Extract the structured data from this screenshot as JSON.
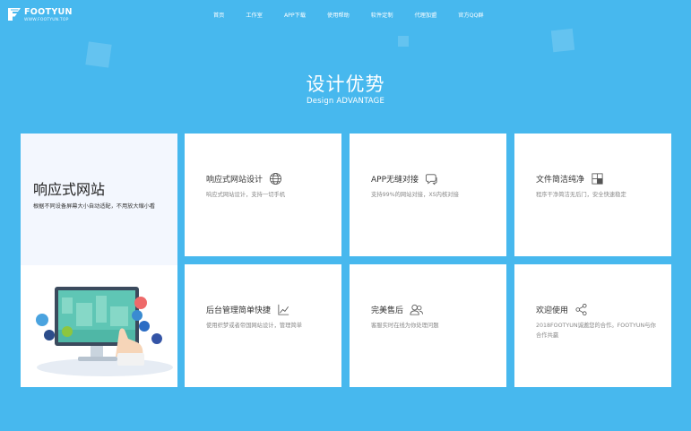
{
  "header": {
    "logo_text": "FOOTYUN",
    "logo_sub": "WWW.FOOTYUN.TOP",
    "nav": [
      "首页",
      "工作室",
      "APP下载",
      "使用帮助",
      "软件定制",
      "代理加盟",
      "官方QQ群"
    ]
  },
  "section": {
    "title": "设计优势",
    "subtitle": "Design ADVANTAGE"
  },
  "feature_big": {
    "title": "响应式网站",
    "desc": "根据不同设备屏幕大小自动适配，不用放大缩小看"
  },
  "cards": [
    {
      "title": "响应式网站设计",
      "icon": "globe-icon",
      "desc": "响应式网站设计，支持一切手机"
    },
    {
      "title": "APP无缝对接",
      "icon": "chat-bubble-icon",
      "desc": "支持99%的网站对接，XS内核对接"
    },
    {
      "title": "文件简洁纯净",
      "icon": "layout-icon",
      "desc": "程序干净简洁无后门，安全快速稳定"
    },
    {
      "title": "后台管理简单快捷",
      "icon": "line-chart-icon",
      "desc": "使用织梦或者帝国网站设计，管理简单"
    },
    {
      "title": "完美售后",
      "icon": "users-icon",
      "desc": "客服实时在线为你处理问题"
    },
    {
      "title": "欢迎使用",
      "icon": "share-icon",
      "desc": "2018FOOTYUN诚邀您的合作。FOOTYUN与你合作共赢"
    }
  ],
  "colors": {
    "background": "#47b8ee",
    "card": "#ffffff",
    "feature_top": "#f3f7fe"
  }
}
